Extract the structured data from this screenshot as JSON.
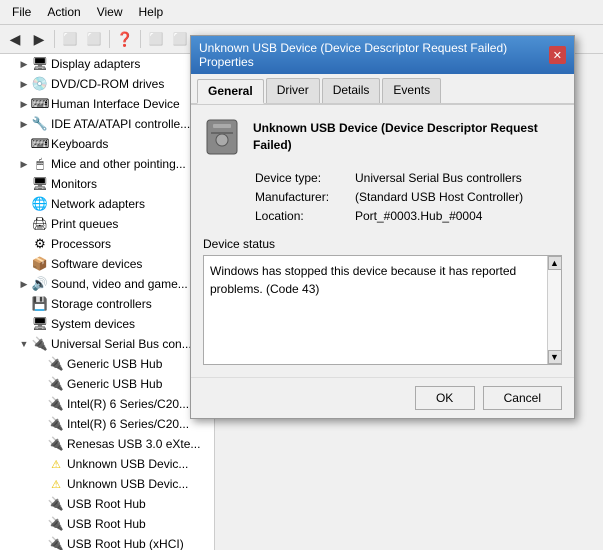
{
  "menu": {
    "items": [
      "File",
      "Action",
      "View",
      "Help"
    ]
  },
  "toolbar": {
    "buttons": [
      "◀",
      "▶",
      "⬛",
      "⬛",
      "❓",
      "⬛",
      "⬛"
    ]
  },
  "tree": {
    "items": [
      {
        "id": "display-adapters",
        "indent": 1,
        "toggle": "▶",
        "icon": "🖥",
        "label": "Display adapters"
      },
      {
        "id": "dvdcdrom",
        "indent": 1,
        "toggle": "▶",
        "icon": "💿",
        "label": "DVD/CD-ROM drives"
      },
      {
        "id": "human-interface",
        "indent": 1,
        "toggle": "▶",
        "icon": "⌨",
        "label": "Human Interface Device"
      },
      {
        "id": "ide-atapi",
        "indent": 1,
        "toggle": "▶",
        "icon": "🔧",
        "label": "IDE ATA/ATAPI controlle..."
      },
      {
        "id": "keyboards",
        "indent": 1,
        "toggle": " ",
        "icon": "⌨",
        "label": "Keyboards"
      },
      {
        "id": "mice",
        "indent": 1,
        "toggle": "▶",
        "icon": "🖱",
        "label": "Mice and other pointing..."
      },
      {
        "id": "monitors",
        "indent": 1,
        "toggle": " ",
        "icon": "🖥",
        "label": "Monitors"
      },
      {
        "id": "network-adapters",
        "indent": 1,
        "toggle": " ",
        "icon": "🌐",
        "label": "Network adapters"
      },
      {
        "id": "print-queues",
        "indent": 1,
        "toggle": " ",
        "icon": "🖨",
        "label": "Print queues"
      },
      {
        "id": "processors",
        "indent": 1,
        "toggle": " ",
        "icon": "⚙",
        "label": "Processors"
      },
      {
        "id": "software-devices",
        "indent": 1,
        "toggle": " ",
        "icon": "📦",
        "label": "Software devices"
      },
      {
        "id": "sound-video",
        "indent": 1,
        "toggle": "▶",
        "icon": "🔊",
        "label": "Sound, video and game..."
      },
      {
        "id": "storage-controllers",
        "indent": 1,
        "toggle": " ",
        "icon": "💾",
        "label": "Storage controllers"
      },
      {
        "id": "system-devices",
        "indent": 1,
        "toggle": " ",
        "icon": "🖥",
        "label": "System devices"
      },
      {
        "id": "usb-controllers",
        "indent": 1,
        "toggle": "▼",
        "icon": "🔌",
        "label": "Universal Serial Bus con..."
      },
      {
        "id": "generic-hub1",
        "indent": 2,
        "toggle": " ",
        "icon": "🔌",
        "label": "Generic USB Hub"
      },
      {
        "id": "generic-hub2",
        "indent": 2,
        "toggle": " ",
        "icon": "🔌",
        "label": "Generic USB Hub"
      },
      {
        "id": "intel-6series1",
        "indent": 2,
        "toggle": " ",
        "icon": "🔌",
        "label": "Intel(R) 6 Series/C20..."
      },
      {
        "id": "intel-6series2",
        "indent": 2,
        "toggle": " ",
        "icon": "🔌",
        "label": "Intel(R) 6 Series/C20..."
      },
      {
        "id": "renesas-usb",
        "indent": 2,
        "toggle": " ",
        "icon": "🔌",
        "label": "Renesas USB 3.0 eXte..."
      },
      {
        "id": "unknown-usb1",
        "indent": 2,
        "toggle": " ",
        "icon": "⚠",
        "label": "Unknown USB Devic..."
      },
      {
        "id": "unknown-usb2",
        "indent": 2,
        "toggle": " ",
        "icon": "⚠",
        "label": "Unknown USB Devic..."
      },
      {
        "id": "usb-root1",
        "indent": 2,
        "toggle": " ",
        "icon": "🔌",
        "label": "USB Root Hub"
      },
      {
        "id": "usb-root2",
        "indent": 2,
        "toggle": " ",
        "icon": "🔌",
        "label": "USB Root Hub"
      },
      {
        "id": "usb-root-xhci",
        "indent": 2,
        "toggle": " ",
        "icon": "🔌",
        "label": "USB Root Hub (xHCI)"
      }
    ]
  },
  "dialog": {
    "title": "Unknown USB Device (Device Descriptor Request Failed) Properties",
    "tabs": [
      "General",
      "Driver",
      "Details",
      "Events"
    ],
    "active_tab": "General",
    "device_icon": "🔌",
    "device_name": "Unknown USB Device (Device Descriptor Request Failed)",
    "fields": {
      "device_type_label": "Device type:",
      "device_type_value": "Universal Serial Bus controllers",
      "manufacturer_label": "Manufacturer:",
      "manufacturer_value": "(Standard USB Host Controller)",
      "location_label": "Location:",
      "location_value": "Port_#0003.Hub_#0004"
    },
    "status_section_label": "Device status",
    "status_text": "Windows has stopped this device because it has reported problems. (Code 43)",
    "buttons": {
      "ok": "OK",
      "cancel": "Cancel"
    }
  }
}
